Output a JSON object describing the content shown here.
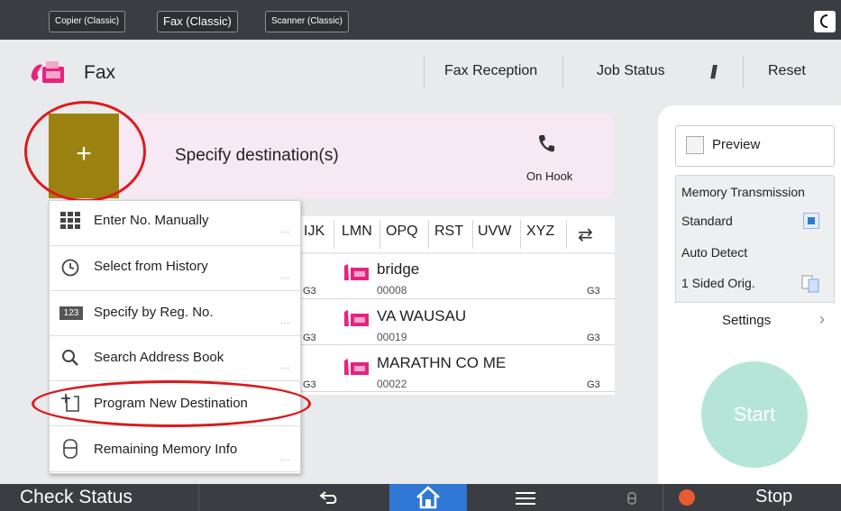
{
  "app_tabs": [
    "Copier (Classic)",
    "Fax (Classic)",
    "Scanner (Classic)"
  ],
  "header": {
    "title": "Fax",
    "fax_reception": "Fax Reception",
    "job_status": "Job Status",
    "reset": "Reset"
  },
  "destination": {
    "plus": "+",
    "label": "Specify destination(s)",
    "on_hook": "On Hook"
  },
  "alpha_tabs": [
    "IJK",
    "LMN",
    "OPQ",
    "RST",
    "UVW",
    "XYZ"
  ],
  "entries": [
    {
      "name": "bridge",
      "number": "00008",
      "mode": "G3"
    },
    {
      "name": "VA WAUSAU",
      "number": "00019",
      "mode": "G3"
    },
    {
      "name": "MARATHN CO ME",
      "number": "00022",
      "mode": "G3"
    }
  ],
  "left_g3": [
    "G3",
    "G3",
    "G3"
  ],
  "menu": [
    {
      "label": "Enter No. Manually",
      "icon": "keypad-icon"
    },
    {
      "label": "Select from History",
      "icon": "clock-icon"
    },
    {
      "label": "Specify by Reg. No.",
      "icon": "reg-number-icon",
      "icon_text": "123"
    },
    {
      "label": "Search Address Book",
      "icon": "search-icon"
    },
    {
      "label": "Program New Destination",
      "icon": "program-destination-icon"
    },
    {
      "label": "Remaining Memory Info",
      "icon": "memory-icon"
    }
  ],
  "menu_dots": "...",
  "right_panel": {
    "preview": "Preview",
    "memory_transmission": "Memory Transmission",
    "standard": "Standard",
    "auto_detect": "Auto Detect",
    "sided": "1 Sided Orig.",
    "settings": "Settings",
    "start": "Start"
  },
  "bottom": {
    "check_status": "Check Status",
    "stop": "Stop"
  },
  "colors": {
    "plus_button": "#9b8210",
    "destination_bg": "#f7e9f3",
    "start_button": "#b5e5d7",
    "home_button": "#3178d4",
    "highlight_red": "#e0191d",
    "fax_pink": "#e6247d"
  }
}
